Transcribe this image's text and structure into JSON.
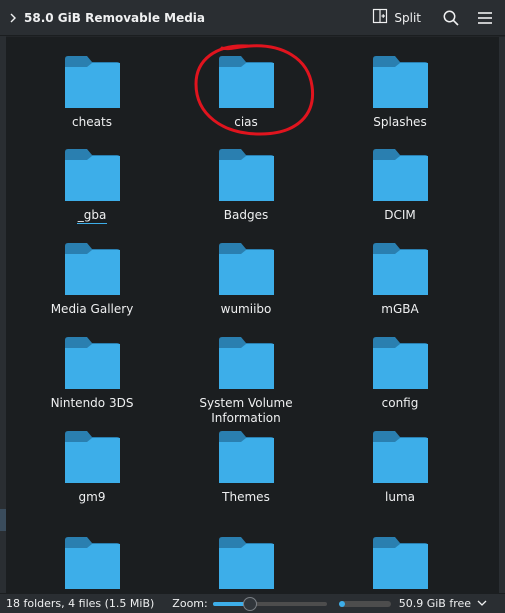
{
  "toolbar": {
    "breadcrumb": "58.0 GiB Removable Media",
    "split_label": "Split",
    "icons": [
      "chevron-right-icon",
      "split-view-icon",
      "search-icon",
      "hamburger-menu-icon"
    ]
  },
  "items": [
    {
      "name": "cheats",
      "type": "folder"
    },
    {
      "name": "cias",
      "type": "folder",
      "circled": true
    },
    {
      "name": "Splashes",
      "type": "folder"
    },
    {
      "name": "_gba",
      "type": "folder",
      "underlined": true
    },
    {
      "name": "Badges",
      "type": "folder"
    },
    {
      "name": "DCIM",
      "type": "folder"
    },
    {
      "name": "Media Gallery",
      "type": "folder"
    },
    {
      "name": "wumiibo",
      "type": "folder"
    },
    {
      "name": "mGBA",
      "type": "folder"
    },
    {
      "name": "Nintendo 3DS",
      "type": "folder"
    },
    {
      "name": "System Volume Information",
      "type": "folder"
    },
    {
      "name": "config",
      "type": "folder"
    },
    {
      "name": "gm9",
      "type": "folder"
    },
    {
      "name": "Themes",
      "type": "folder"
    },
    {
      "name": "luma",
      "type": "folder"
    },
    {
      "name": "",
      "type": "folder"
    },
    {
      "name": "",
      "type": "folder"
    },
    {
      "name": "",
      "type": "folder"
    }
  ],
  "status": {
    "summary": "18 folders, 4 files (1.5 MiB)",
    "zoom_label": "Zoom:",
    "zoom_level": 0.3,
    "disk_used_fraction": 0.12,
    "free_text": "50.9 GiB free"
  },
  "colors": {
    "accent": "#3daee9",
    "folder_body": "#3daee9",
    "folder_tab": "#2a7fb0",
    "annotation": "#e0141e",
    "background": "#1b1e20"
  }
}
